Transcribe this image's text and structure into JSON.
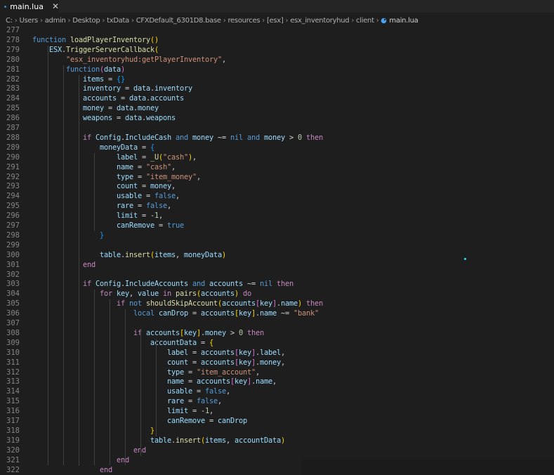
{
  "tab": {
    "label": "main.lua",
    "close": "✕"
  },
  "breadcrumb": [
    "C:",
    "Users",
    "admin",
    "Desktop",
    "txData",
    "CFXDefault_6301D8.base",
    "resources",
    "[esx]",
    "esx_inventoryhud",
    "client",
    "main.lua"
  ],
  "colors": {
    "keyword": "#569cd6",
    "function": "#dcdcaa",
    "variable": "#9cdcfe",
    "string": "#ce9178",
    "number": "#b5cea8",
    "background": "#1e1e1e"
  },
  "lines": [
    {
      "n": "277",
      "t": [
        [
          "",
          ""
        ]
      ]
    },
    {
      "n": "278",
      "t": [
        [
          "kw",
          "function "
        ],
        [
          "fn",
          "loadPlayerInventory"
        ],
        [
          "brk",
          "()"
        ]
      ]
    },
    {
      "n": "279",
      "t": [
        [
          "def",
          "    "
        ],
        [
          "var",
          "ESX"
        ],
        [
          "op",
          "."
        ],
        [
          "fn",
          "TriggerServerCallback"
        ],
        [
          "brk",
          "("
        ]
      ]
    },
    {
      "n": "280",
      "t": [
        [
          "def",
          "        "
        ],
        [
          "str",
          "\"esx_inventoryhud:getPlayerInventory\""
        ],
        [
          "op",
          ","
        ]
      ]
    },
    {
      "n": "281",
      "t": [
        [
          "def",
          "        "
        ],
        [
          "kw",
          "function"
        ],
        [
          "brk2",
          "("
        ],
        [
          "var",
          "data"
        ],
        [
          "brk2",
          ")"
        ]
      ]
    },
    {
      "n": "282",
      "t": [
        [
          "def",
          "            "
        ],
        [
          "var",
          "items"
        ],
        [
          "op",
          " = "
        ],
        [
          "brk3",
          "{}"
        ]
      ]
    },
    {
      "n": "283",
      "t": [
        [
          "def",
          "            "
        ],
        [
          "var",
          "inventory"
        ],
        [
          "op",
          " = "
        ],
        [
          "var",
          "data"
        ],
        [
          "op",
          "."
        ],
        [
          "var",
          "inventory"
        ]
      ]
    },
    {
      "n": "284",
      "t": [
        [
          "def",
          "            "
        ],
        [
          "var",
          "accounts"
        ],
        [
          "op",
          " = "
        ],
        [
          "var",
          "data"
        ],
        [
          "op",
          "."
        ],
        [
          "var",
          "accounts"
        ]
      ]
    },
    {
      "n": "285",
      "t": [
        [
          "def",
          "            "
        ],
        [
          "var",
          "money"
        ],
        [
          "op",
          " = "
        ],
        [
          "var",
          "data"
        ],
        [
          "op",
          "."
        ],
        [
          "var",
          "money"
        ]
      ]
    },
    {
      "n": "286",
      "t": [
        [
          "def",
          "            "
        ],
        [
          "var",
          "weapons"
        ],
        [
          "op",
          " = "
        ],
        [
          "var",
          "data"
        ],
        [
          "op",
          "."
        ],
        [
          "var",
          "weapons"
        ]
      ]
    },
    {
      "n": "287",
      "t": [
        [
          "",
          ""
        ]
      ]
    },
    {
      "n": "288",
      "t": [
        [
          "def",
          "            "
        ],
        [
          "ctl",
          "if "
        ],
        [
          "var",
          "Config"
        ],
        [
          "op",
          "."
        ],
        [
          "var",
          "IncludeCash"
        ],
        [
          "kw",
          " and "
        ],
        [
          "var",
          "money"
        ],
        [
          "op",
          " ~= "
        ],
        [
          "const",
          "nil"
        ],
        [
          "kw",
          " and "
        ],
        [
          "var",
          "money"
        ],
        [
          "op",
          " > "
        ],
        [
          "num",
          "0"
        ],
        [
          "ctl",
          " then"
        ]
      ]
    },
    {
      "n": "289",
      "t": [
        [
          "def",
          "                "
        ],
        [
          "var",
          "moneyData"
        ],
        [
          "op",
          " = "
        ],
        [
          "brk3",
          "{"
        ]
      ]
    },
    {
      "n": "290",
      "t": [
        [
          "def",
          "                    "
        ],
        [
          "var",
          "label"
        ],
        [
          "op",
          " = "
        ],
        [
          "fn",
          "_U"
        ],
        [
          "brk",
          "("
        ],
        [
          "str",
          "\"cash\""
        ],
        [
          "brk",
          ")"
        ],
        [
          "op",
          ","
        ]
      ]
    },
    {
      "n": "291",
      "t": [
        [
          "def",
          "                    "
        ],
        [
          "var",
          "name"
        ],
        [
          "op",
          " = "
        ],
        [
          "str",
          "\"cash\""
        ],
        [
          "op",
          ","
        ]
      ]
    },
    {
      "n": "292",
      "t": [
        [
          "def",
          "                    "
        ],
        [
          "var",
          "type"
        ],
        [
          "op",
          " = "
        ],
        [
          "str",
          "\"item_money\""
        ],
        [
          "op",
          ","
        ]
      ]
    },
    {
      "n": "293",
      "t": [
        [
          "def",
          "                    "
        ],
        [
          "var",
          "count"
        ],
        [
          "op",
          " = "
        ],
        [
          "var",
          "money"
        ],
        [
          "op",
          ","
        ]
      ]
    },
    {
      "n": "294",
      "t": [
        [
          "def",
          "                    "
        ],
        [
          "var",
          "usable"
        ],
        [
          "op",
          " = "
        ],
        [
          "const",
          "false"
        ],
        [
          "op",
          ","
        ]
      ]
    },
    {
      "n": "295",
      "t": [
        [
          "def",
          "                    "
        ],
        [
          "var",
          "rare"
        ],
        [
          "op",
          " = "
        ],
        [
          "const",
          "false"
        ],
        [
          "op",
          ","
        ]
      ]
    },
    {
      "n": "296",
      "t": [
        [
          "def",
          "                    "
        ],
        [
          "var",
          "limit"
        ],
        [
          "op",
          " = -"
        ],
        [
          "num",
          "1"
        ],
        [
          "op",
          ","
        ]
      ]
    },
    {
      "n": "297",
      "t": [
        [
          "def",
          "                    "
        ],
        [
          "var",
          "canRemove"
        ],
        [
          "op",
          " = "
        ],
        [
          "const",
          "true"
        ]
      ]
    },
    {
      "n": "298",
      "t": [
        [
          "def",
          "                "
        ],
        [
          "brk3",
          "}"
        ]
      ]
    },
    {
      "n": "299",
      "t": [
        [
          "",
          ""
        ]
      ]
    },
    {
      "n": "300",
      "t": [
        [
          "def",
          "                "
        ],
        [
          "var",
          "table"
        ],
        [
          "op",
          "."
        ],
        [
          "fn",
          "insert"
        ],
        [
          "brk",
          "("
        ],
        [
          "var",
          "items"
        ],
        [
          "op",
          ", "
        ],
        [
          "var",
          "moneyData"
        ],
        [
          "brk",
          ")"
        ]
      ]
    },
    {
      "n": "301",
      "t": [
        [
          "def",
          "            "
        ],
        [
          "ctl",
          "end"
        ]
      ]
    },
    {
      "n": "302",
      "t": [
        [
          "",
          ""
        ]
      ]
    },
    {
      "n": "303",
      "t": [
        [
          "def",
          "            "
        ],
        [
          "ctl",
          "if "
        ],
        [
          "var",
          "Config"
        ],
        [
          "op",
          "."
        ],
        [
          "var",
          "IncludeAccounts"
        ],
        [
          "kw",
          " and "
        ],
        [
          "var",
          "accounts"
        ],
        [
          "op",
          " ~= "
        ],
        [
          "const",
          "nil"
        ],
        [
          "ctl",
          " then"
        ]
      ]
    },
    {
      "n": "304",
      "t": [
        [
          "def",
          "                "
        ],
        [
          "ctl",
          "for "
        ],
        [
          "var",
          "key"
        ],
        [
          "op",
          ", "
        ],
        [
          "var",
          "value"
        ],
        [
          "ctl",
          " in "
        ],
        [
          "fn",
          "pairs"
        ],
        [
          "brk",
          "("
        ],
        [
          "var",
          "accounts"
        ],
        [
          "brk",
          ")"
        ],
        [
          "ctl",
          " do"
        ]
      ]
    },
    {
      "n": "305",
      "t": [
        [
          "def",
          "                    "
        ],
        [
          "ctl",
          "if "
        ],
        [
          "kw",
          "not "
        ],
        [
          "fn",
          "shouldSkipAccount"
        ],
        [
          "brk",
          "("
        ],
        [
          "var",
          "accounts"
        ],
        [
          "brk2",
          "["
        ],
        [
          "var",
          "key"
        ],
        [
          "brk2",
          "]"
        ],
        [
          "op",
          "."
        ],
        [
          "var",
          "name"
        ],
        [
          "brk",
          ")"
        ],
        [
          "ctl",
          " then"
        ]
      ]
    },
    {
      "n": "306",
      "t": [
        [
          "def",
          "                        "
        ],
        [
          "kw",
          "local "
        ],
        [
          "var",
          "canDrop"
        ],
        [
          "op",
          " = "
        ],
        [
          "var",
          "accounts"
        ],
        [
          "brk",
          "["
        ],
        [
          "var",
          "key"
        ],
        [
          "brk",
          "]"
        ],
        [
          "op",
          "."
        ],
        [
          "var",
          "name"
        ],
        [
          "op",
          " ~= "
        ],
        [
          "str",
          "\"bank\""
        ]
      ]
    },
    {
      "n": "307",
      "t": [
        [
          "",
          ""
        ]
      ]
    },
    {
      "n": "308",
      "t": [
        [
          "def",
          "                        "
        ],
        [
          "ctl",
          "if "
        ],
        [
          "var",
          "accounts"
        ],
        [
          "brk",
          "["
        ],
        [
          "var",
          "key"
        ],
        [
          "brk",
          "]"
        ],
        [
          "op",
          "."
        ],
        [
          "var",
          "money"
        ],
        [
          "op",
          " > "
        ],
        [
          "num",
          "0"
        ],
        [
          "ctl",
          " then"
        ]
      ]
    },
    {
      "n": "309",
      "t": [
        [
          "def",
          "                            "
        ],
        [
          "var",
          "accountData"
        ],
        [
          "op",
          " = "
        ],
        [
          "brk",
          "{"
        ]
      ]
    },
    {
      "n": "310",
      "t": [
        [
          "def",
          "                                "
        ],
        [
          "var",
          "label"
        ],
        [
          "op",
          " = "
        ],
        [
          "var",
          "accounts"
        ],
        [
          "brk2",
          "["
        ],
        [
          "var",
          "key"
        ],
        [
          "brk2",
          "]"
        ],
        [
          "op",
          "."
        ],
        [
          "var",
          "label"
        ],
        [
          "op",
          ","
        ]
      ]
    },
    {
      "n": "311",
      "t": [
        [
          "def",
          "                                "
        ],
        [
          "var",
          "count"
        ],
        [
          "op",
          " = "
        ],
        [
          "var",
          "accounts"
        ],
        [
          "brk2",
          "["
        ],
        [
          "var",
          "key"
        ],
        [
          "brk2",
          "]"
        ],
        [
          "op",
          "."
        ],
        [
          "var",
          "money"
        ],
        [
          "op",
          ","
        ]
      ]
    },
    {
      "n": "312",
      "t": [
        [
          "def",
          "                                "
        ],
        [
          "var",
          "type"
        ],
        [
          "op",
          " = "
        ],
        [
          "str",
          "\"item_account\""
        ],
        [
          "op",
          ","
        ]
      ]
    },
    {
      "n": "313",
      "t": [
        [
          "def",
          "                                "
        ],
        [
          "var",
          "name"
        ],
        [
          "op",
          " = "
        ],
        [
          "var",
          "accounts"
        ],
        [
          "brk2",
          "["
        ],
        [
          "var",
          "key"
        ],
        [
          "brk2",
          "]"
        ],
        [
          "op",
          "."
        ],
        [
          "var",
          "name"
        ],
        [
          "op",
          ","
        ]
      ]
    },
    {
      "n": "314",
      "t": [
        [
          "def",
          "                                "
        ],
        [
          "var",
          "usable"
        ],
        [
          "op",
          " = "
        ],
        [
          "const",
          "false"
        ],
        [
          "op",
          ","
        ]
      ]
    },
    {
      "n": "315",
      "t": [
        [
          "def",
          "                                "
        ],
        [
          "var",
          "rare"
        ],
        [
          "op",
          " = "
        ],
        [
          "const",
          "false"
        ],
        [
          "op",
          ","
        ]
      ]
    },
    {
      "n": "316",
      "t": [
        [
          "def",
          "                                "
        ],
        [
          "var",
          "limit"
        ],
        [
          "op",
          " = -"
        ],
        [
          "num",
          "1"
        ],
        [
          "op",
          ","
        ]
      ]
    },
    {
      "n": "317",
      "t": [
        [
          "def",
          "                                "
        ],
        [
          "var",
          "canRemove"
        ],
        [
          "op",
          " = "
        ],
        [
          "var",
          "canDrop"
        ]
      ]
    },
    {
      "n": "318",
      "t": [
        [
          "def",
          "                            "
        ],
        [
          "brk",
          "}"
        ]
      ]
    },
    {
      "n": "319",
      "t": [
        [
          "def",
          "                            "
        ],
        [
          "var",
          "table"
        ],
        [
          "op",
          "."
        ],
        [
          "fn",
          "insert"
        ],
        [
          "brk",
          "("
        ],
        [
          "var",
          "items"
        ],
        [
          "op",
          ", "
        ],
        [
          "var",
          "accountData"
        ],
        [
          "brk",
          ")"
        ]
      ]
    },
    {
      "n": "320",
      "t": [
        [
          "def",
          "                        "
        ],
        [
          "ctl",
          "end"
        ]
      ]
    },
    {
      "n": "321",
      "t": [
        [
          "def",
          "                    "
        ],
        [
          "ctl",
          "end"
        ]
      ]
    },
    {
      "n": "322",
      "t": [
        [
          "def",
          "                "
        ],
        [
          "ctl",
          "end"
        ]
      ]
    }
  ]
}
